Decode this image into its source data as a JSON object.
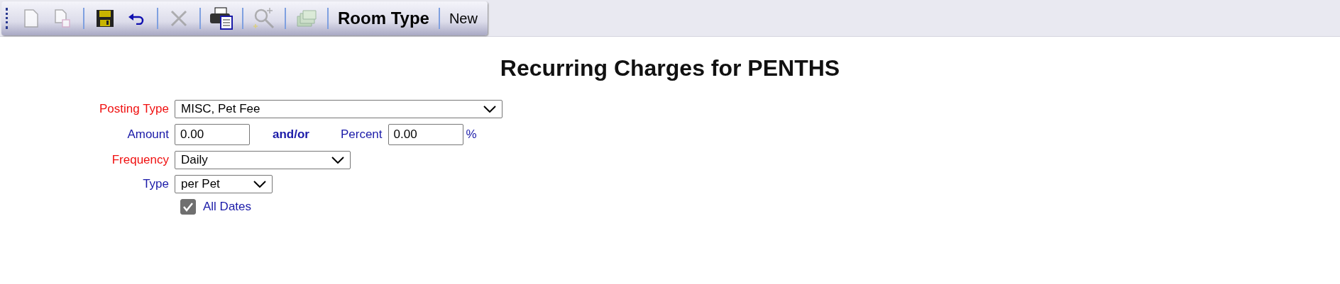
{
  "toolbar": {
    "buttons": [
      {
        "kind": "page",
        "disabled": true
      },
      {
        "kind": "copy",
        "disabled": true
      },
      {
        "kind": "save",
        "disabled": false
      },
      {
        "kind": "undo",
        "disabled": false
      },
      {
        "kind": "delete",
        "disabled": true
      },
      {
        "kind": "print",
        "disabled": false
      },
      {
        "kind": "zoom",
        "disabled": true
      },
      {
        "kind": "money",
        "disabled": true
      }
    ],
    "text_buttons": [
      {
        "label": "Room Type",
        "bold": true
      },
      {
        "label": "New",
        "bold": false
      }
    ]
  },
  "title": "Recurring Charges for PENTHS",
  "form": {
    "posting_type": {
      "label": "Posting Type",
      "required": true,
      "value": "MISC, Pet Fee"
    },
    "amount": {
      "label": "Amount",
      "required": false,
      "value": "0.00"
    },
    "and_or": "and/or",
    "percent": {
      "label": "Percent",
      "required": false,
      "value": "0.00",
      "unit": "%"
    },
    "frequency": {
      "label": "Frequency",
      "required": true,
      "value": "Daily"
    },
    "type": {
      "label": "Type",
      "required": false,
      "value": "per Pet"
    },
    "all_dates": {
      "label": "All Dates",
      "checked": true
    }
  }
}
